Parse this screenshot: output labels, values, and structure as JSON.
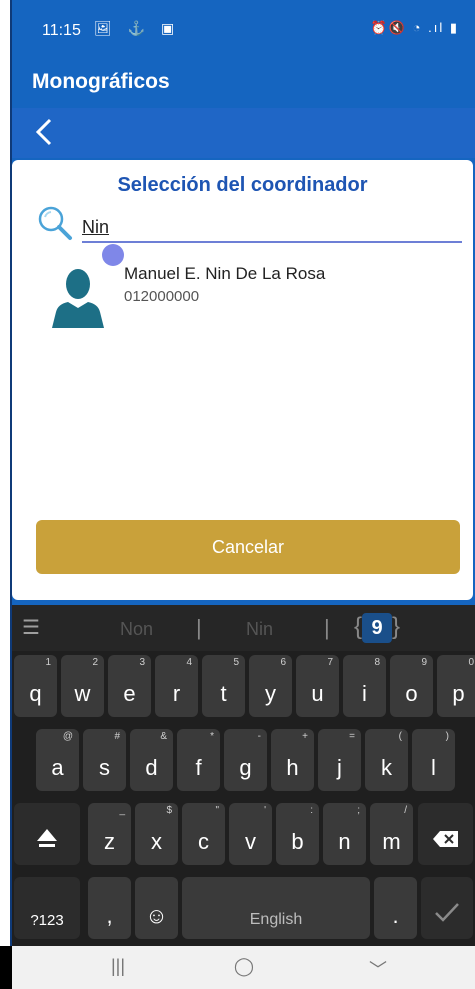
{
  "status": {
    "time": "11:15",
    "left_icons": "🖼 ⚓ ▣",
    "right_icons": "⏰🔇 ◔ .ıl ▮"
  },
  "appbar": {
    "title": "Monográficos"
  },
  "card": {
    "heading": "Selección del coordinador"
  },
  "search": {
    "value": "Nin"
  },
  "results": [
    {
      "name": "Manuel E. Nin De La Rosa",
      "code": "012000000"
    }
  ],
  "buttons": {
    "cancel": "Cancelar"
  },
  "keyboard": {
    "menu": "☰",
    "suggestions": [
      "Non",
      "Nin"
    ],
    "number_key": "9",
    "row1": [
      {
        "k": "q",
        "s": "1"
      },
      {
        "k": "w",
        "s": "2"
      },
      {
        "k": "e",
        "s": "3"
      },
      {
        "k": "r",
        "s": "4"
      },
      {
        "k": "t",
        "s": "5"
      },
      {
        "k": "y",
        "s": "6"
      },
      {
        "k": "u",
        "s": "7"
      },
      {
        "k": "i",
        "s": "8"
      },
      {
        "k": "o",
        "s": "9"
      },
      {
        "k": "p",
        "s": "0"
      }
    ],
    "row2": [
      {
        "k": "a",
        "s": "@"
      },
      {
        "k": "s",
        "s": "#"
      },
      {
        "k": "d",
        "s": "&"
      },
      {
        "k": "f",
        "s": "*"
      },
      {
        "k": "g",
        "s": "-"
      },
      {
        "k": "h",
        "s": "+"
      },
      {
        "k": "j",
        "s": "="
      },
      {
        "k": "k",
        "s": "("
      },
      {
        "k": "l",
        "s": ")"
      }
    ],
    "row3": [
      {
        "k": "z",
        "s": "_"
      },
      {
        "k": "x",
        "s": "$"
      },
      {
        "k": "c",
        "s": "\""
      },
      {
        "k": "v",
        "s": "'"
      },
      {
        "k": "b",
        "s": ":"
      },
      {
        "k": "n",
        "s": ";"
      },
      {
        "k": "m",
        "s": "/"
      }
    ],
    "sym_label": "?123",
    "comma": ",",
    "emoji": "☺",
    "space": "English",
    "period": "."
  },
  "nav": {
    "recents": "|||",
    "home": "◯",
    "back": "﹀"
  }
}
